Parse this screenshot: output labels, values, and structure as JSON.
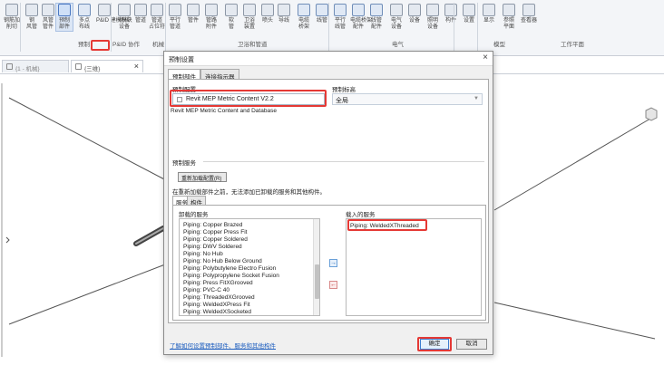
{
  "ribbon": {
    "tools": [
      {
        "label": "钢筋加\n削切",
        "icon": "rebar-cut-icon"
      },
      {
        "label": "钢\n风管",
        "icon": "duct-icon"
      },
      {
        "label": "风管\n管件",
        "icon": "duct-fitting-icon"
      },
      {
        "label": "预制\n部件",
        "icon": "fabrication-part-icon"
      },
      {
        "label": "多点\n布线",
        "icon": "multi-point-route-icon"
      },
      {
        "label": "P&ID 建模模块",
        "icon": "pid-modeler-icon"
      },
      {
        "label": "机械\n设备",
        "icon": "mechanical-equipment-icon"
      },
      {
        "label": "管道",
        "icon": "pipe-icon"
      },
      {
        "label": "管道\n占位符",
        "icon": "pipe-placeholder-icon"
      },
      {
        "label": "平行\n管道",
        "icon": "parallel-pipes-icon"
      },
      {
        "label": "管件",
        "icon": "pipe-fitting-icon"
      },
      {
        "label": "管路\n附件",
        "icon": "pipe-accessory-icon"
      },
      {
        "label": "软\n管",
        "icon": "flex-pipe-icon"
      },
      {
        "label": "卫浴\n装置",
        "icon": "plumbing-fixture-icon"
      },
      {
        "label": "喷头",
        "icon": "sprinkler-icon"
      },
      {
        "label": "导线",
        "icon": "wire-icon"
      },
      {
        "label": "电缆\n桥架",
        "icon": "cable-tray-icon"
      },
      {
        "label": "线管",
        "icon": "conduit-icon"
      },
      {
        "label": "平行\n线管",
        "icon": "parallel-conduits-icon"
      },
      {
        "label": "电缆桥架\n配件",
        "icon": "cable-tray-fitting-icon"
      },
      {
        "label": "线管\n配件",
        "icon": "conduit-fitting-icon"
      },
      {
        "label": "电气\n设备",
        "icon": "electrical-equipment-icon"
      },
      {
        "label": "设备",
        "icon": "device-icon"
      },
      {
        "label": "照明\n设备",
        "icon": "lighting-fixture-icon"
      },
      {
        "label": "构件",
        "icon": "component-icon"
      },
      {
        "label": "设置",
        "icon": "settings-icon"
      },
      {
        "label": "显示",
        "icon": "show-icon"
      },
      {
        "label": "参照\n平面",
        "icon": "reference-plane-icon"
      },
      {
        "label": "查看器",
        "icon": "viewer-icon"
      }
    ],
    "panels": {
      "fabrication": "预制",
      "pid": "P&ID 协作",
      "mechanical": "机械",
      "plumbing": "卫浴和管道",
      "electrical": "电气",
      "model": "模型",
      "workplane": "工作平面"
    }
  },
  "tabs": [
    {
      "label": "{1 - 机械}"
    },
    {
      "label": "{三维}"
    }
  ],
  "dialog": {
    "title": "预制设置",
    "close_label": "×",
    "tabs": [
      "预制部件",
      "连接指示器"
    ],
    "config_label": "预制配置",
    "config_value": "Revit MEP Metric Content V2.2",
    "scope_label": "预制标高",
    "scope_value": "全局",
    "config_desc": "Revit MEP Metric Content and Database",
    "services_label": "预制服务",
    "reload_label": "重新加载配置(R)",
    "notice": "在重新加载部件之前，无法添加已卸载的服务和其他构件。",
    "service_tabs": [
      "服务",
      "构件"
    ],
    "unloaded_label": "卸载的服务",
    "loaded_label": "载入的服务",
    "unloaded_services": [
      "Piping: Copper Brazed",
      "Piping: Copper Press Fit",
      "Piping: Copper Soldered",
      "Piping: DWV Soldered",
      "Piping: No Hub",
      "Piping: No Hub Below Ground",
      "Piping: Polybutylene Electro Fusion",
      "Piping: Polypropylene Socket Fusion",
      "Piping: Press FitXGrooved",
      "Piping: PVC-C 40",
      "Piping: ThreadedXGrooved",
      "Piping: WeldedXPress Fit",
      "Piping: WeldedXSocketed"
    ],
    "loaded_services": [
      "Piping: WeldedXThreaded"
    ],
    "help_link": "了解如何设置预制部件、服务和其他构件",
    "ok_label": "确定",
    "cancel_label": "取消"
  }
}
